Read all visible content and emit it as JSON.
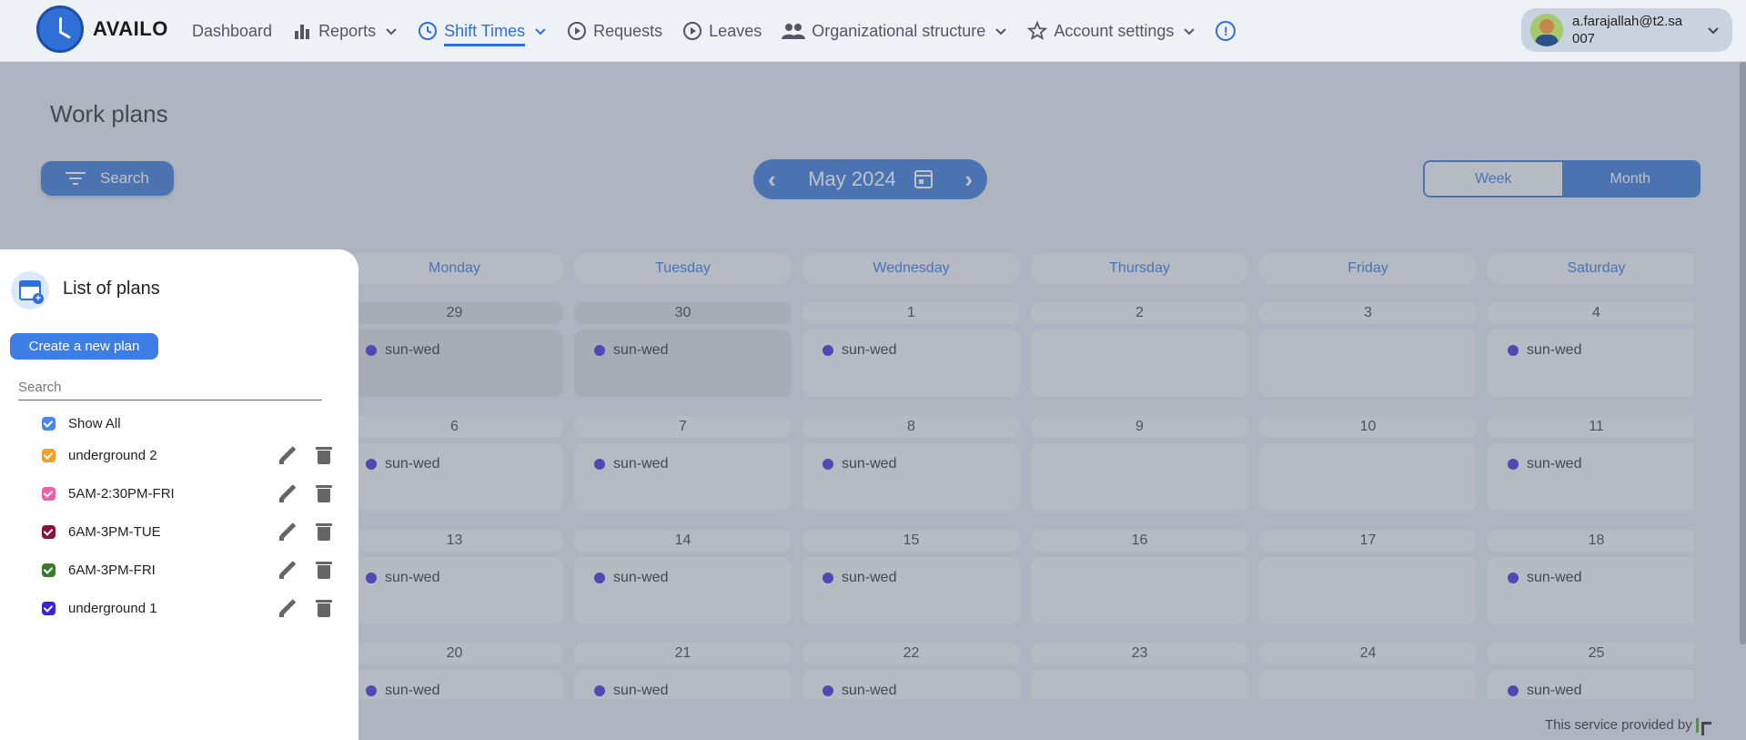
{
  "app": {
    "brand": "AVAILO"
  },
  "nav": {
    "items": [
      {
        "label": "Dashboard",
        "icon": "none",
        "has_dropdown": false,
        "active": false
      },
      {
        "label": "Reports",
        "icon": "bar-chart-icon",
        "has_dropdown": true,
        "active": false
      },
      {
        "label": "Shift Times",
        "icon": "clock-icon",
        "has_dropdown": true,
        "active": true
      },
      {
        "label": "Requests",
        "icon": "play-circle-icon",
        "has_dropdown": false,
        "active": false
      },
      {
        "label": "Leaves",
        "icon": "play-circle-icon",
        "has_dropdown": false,
        "active": false
      },
      {
        "label": "Organizational structure",
        "icon": "people-icon",
        "has_dropdown": true,
        "active": false
      },
      {
        "label": "Account settings",
        "icon": "star-icon",
        "has_dropdown": true,
        "active": false
      }
    ],
    "info_icon": "!"
  },
  "user": {
    "email": "a.farajallah@t2.sa",
    "id": "007"
  },
  "page": {
    "title": "Work plans"
  },
  "toolbar": {
    "search_label": "Search",
    "month_label": "May 2024",
    "prev_arrow": "‹",
    "next_arrow": "›",
    "view_week": "Week",
    "view_month": "Month",
    "view_selected": "Month"
  },
  "calendar": {
    "headers": [
      "Monday",
      "Tuesday",
      "Wednesday",
      "Thursday",
      "Friday",
      "Saturday"
    ],
    "weeks": [
      {
        "dates": [
          "29",
          "30",
          "1",
          "2",
          "3",
          "4"
        ],
        "prev_month": [
          true,
          true,
          false,
          false,
          false,
          false
        ],
        "events": [
          "sun-wed",
          "sun-wed",
          "sun-wed",
          "",
          "",
          "sun-wed"
        ]
      },
      {
        "dates": [
          "6",
          "7",
          "8",
          "9",
          "10",
          "11"
        ],
        "prev_month": [
          false,
          false,
          false,
          false,
          false,
          false
        ],
        "events": [
          "sun-wed",
          "sun-wed",
          "sun-wed",
          "",
          "",
          "sun-wed"
        ]
      },
      {
        "dates": [
          "13",
          "14",
          "15",
          "16",
          "17",
          "18"
        ],
        "prev_month": [
          false,
          false,
          false,
          false,
          false,
          false
        ],
        "events": [
          "sun-wed",
          "sun-wed",
          "sun-wed",
          "",
          "",
          "sun-wed"
        ]
      },
      {
        "dates": [
          "20",
          "21",
          "22",
          "23",
          "24",
          "25"
        ],
        "prev_month": [
          false,
          false,
          false,
          false,
          false,
          false
        ],
        "events": [
          "sun-wed",
          "sun-wed",
          "sun-wed",
          "",
          "",
          "sun-wed"
        ]
      }
    ],
    "event_color": "#3a22d6"
  },
  "panel": {
    "title": "List of plans",
    "create_label": "Create a new plan",
    "search_placeholder": "Search",
    "plans": [
      {
        "label": "Show All",
        "color": "#4c86e8",
        "actions": false
      },
      {
        "label": "underground 2",
        "color": "#f0a024",
        "actions": true
      },
      {
        "label": "5AM-2:30PM-FRI",
        "color": "#ef5fa6",
        "actions": true
      },
      {
        "label": "6AM-3PM-TUE",
        "color": "#8a1040",
        "actions": true
      },
      {
        "label": "6AM-3PM-FRI",
        "color": "#3a7a2a",
        "actions": true
      },
      {
        "label": "underground 1",
        "color": "#3a22d6",
        "actions": true
      }
    ]
  },
  "footer": {
    "note": "This service provided by"
  },
  "colors": {
    "accent": "#2f6fd6",
    "overlay": "rgba(110,120,135,0.45)"
  }
}
